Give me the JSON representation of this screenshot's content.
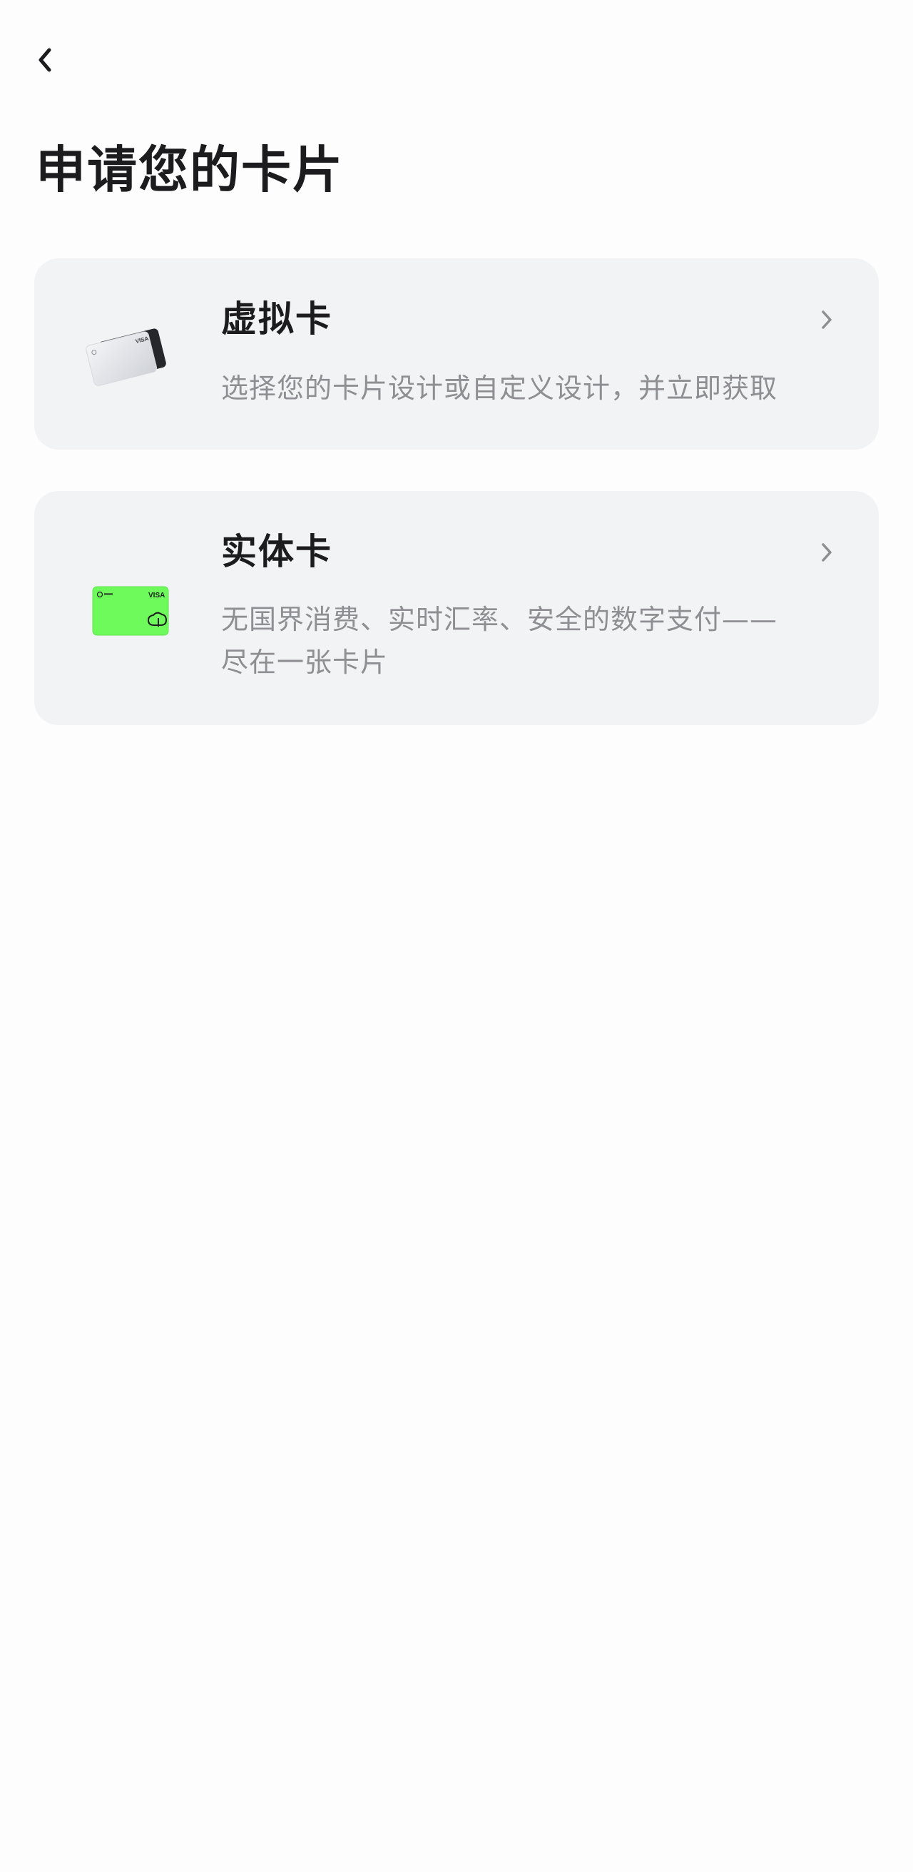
{
  "header": {
    "back_icon": "chevron-left-icon",
    "title": "申请您的卡片"
  },
  "options": [
    {
      "title": "虚拟卡",
      "description": "选择您的卡片设计或自定义设计，并立即获取",
      "icon": "virtual-card-icon",
      "card_brand": "VISA",
      "card_colors": {
        "front": "#e4e6ea",
        "back": "#2a2b2e"
      }
    },
    {
      "title": "实体卡",
      "description_line1": "无国界消费、实时汇率、安全的数字支付——",
      "description_line2": "尽在一张卡片",
      "icon": "physical-card-icon",
      "card_brand": "VISA",
      "card_colors": {
        "front": "#6dfa5a"
      }
    }
  ],
  "colors": {
    "background": "#fdfdfd",
    "card_background": "#f2f3f5",
    "title_text": "#1c1c1e",
    "secondary_text": "#8e8e93",
    "accent_green": "#6dfa5a"
  }
}
